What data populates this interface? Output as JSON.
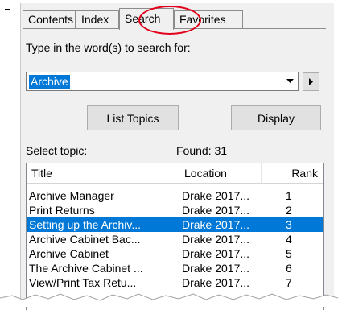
{
  "tabs": [
    {
      "label": "Contents",
      "active": false
    },
    {
      "label": "Index",
      "active": false
    },
    {
      "label": "Search",
      "active": true
    },
    {
      "label": "Favorites",
      "active": false
    }
  ],
  "search": {
    "prompt": "Type in the word(s) to search for:",
    "value": "Archive",
    "dropdown_icon": "chevron-down-icon",
    "arrow_icon": "arrow-right-icon"
  },
  "buttons": {
    "list_topics": "List Topics",
    "display": "Display"
  },
  "results": {
    "select_label": "Select topic:",
    "found_label": "Found: 31",
    "columns": [
      "Title",
      "Location",
      "Rank"
    ],
    "rows": [
      {
        "title": "Archive Manager",
        "location": "Drake 2017...",
        "rank": "1",
        "selected": false
      },
      {
        "title": "Print Returns",
        "location": "Drake 2017...",
        "rank": "2",
        "selected": false
      },
      {
        "title": "Setting up the Archiv...",
        "location": "Drake 2017...",
        "rank": "3",
        "selected": true
      },
      {
        "title": "Archive Cabinet Bac...",
        "location": "Drake 2017...",
        "rank": "4",
        "selected": false
      },
      {
        "title": "Archive Cabinet",
        "location": "Drake 2017...",
        "rank": "5",
        "selected": false
      },
      {
        "title": "The Archive Cabinet ...",
        "location": "Drake 2017...",
        "rank": "6",
        "selected": false
      },
      {
        "title": "View/Print Tax Retu...",
        "location": "Drake 2017...",
        "rank": "7",
        "selected": false
      }
    ]
  },
  "colors": {
    "selection": "#0078d7",
    "highlight_circle": "#e3001b"
  }
}
